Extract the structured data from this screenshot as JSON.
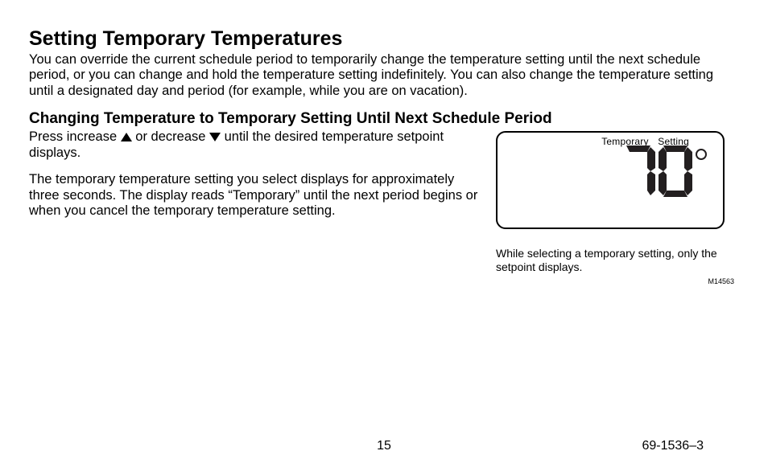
{
  "heading": "Setting Temporary Temperatures",
  "intro": "You can override the current schedule period to temporarily change the temperature setting until the next schedule period, or you can change and hold the temperature setting indefinitely. You can also change the temperature setting until a designated day and period (for example, while you are on vacation).",
  "subheading": "Changing Temperature to Temporary Setting Until Next Schedule Period",
  "body": {
    "p1a": "Press increase ",
    "p1b": " or decrease ",
    "p1c": " until the desired temperature setpoint displays.",
    "p2": "The temporary temperature setting you select displays for approximately three seconds. The display reads “Temporary” until the next period begins or when you cancel the temporary temperature setting."
  },
  "display": {
    "label": "Temporary   Setting",
    "temperature": "70",
    "mcode": "M14563",
    "caption": "While selecting a temporary setting, only the setpoint displays."
  },
  "footer": {
    "page_number": "15",
    "doc_number": "69-1536–3"
  }
}
